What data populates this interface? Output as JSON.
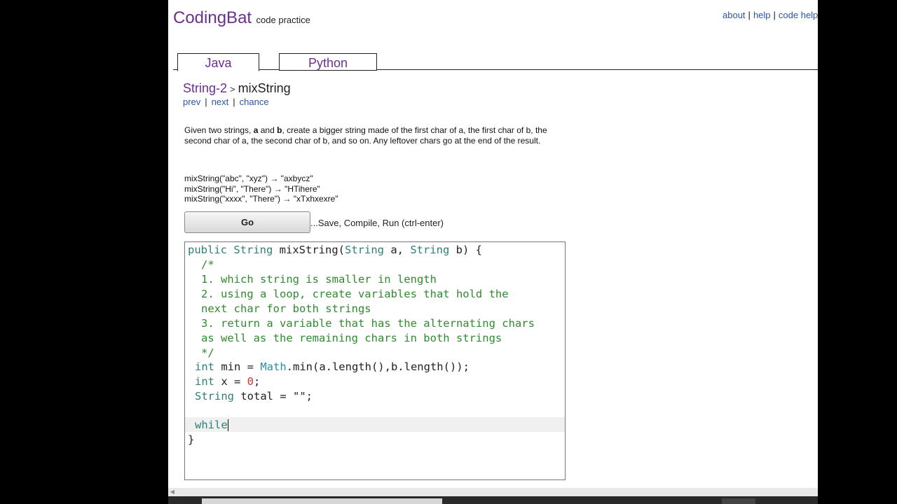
{
  "header": {
    "brand": "CodingBat",
    "tagline": "code practice",
    "links": [
      "about",
      "help",
      "code help"
    ]
  },
  "tabs": [
    {
      "label": "Java",
      "active": true
    },
    {
      "label": "Python",
      "active": false
    }
  ],
  "problem": {
    "group": "String-2",
    "separator": ">",
    "name": "mixString",
    "nav": [
      "prev",
      "next",
      "chance"
    ],
    "description_parts": {
      "p1": "Given two strings, ",
      "a": "a",
      "p2": " and ",
      "b": "b",
      "p3": ", create a bigger string made of the first char of a, the first char of b, the second char of a, the second char of b, and so on. Any leftover chars go at the end of the result."
    },
    "examples": [
      "mixString(\"abc\", \"xyz\") → \"axbycz\"",
      "mixString(\"Hi\", \"There\") → \"HTihere\"",
      "mixString(\"xxxx\", \"There\") → \"xTxhxexre\""
    ]
  },
  "run": {
    "button_label": "Go",
    "hint": "...Save, Compile, Run (ctrl-enter)"
  },
  "colors": {
    "brand": "#6b2f8c",
    "link": "#2a55a8",
    "keyword": "#2f7f78",
    "comment": "#2e8b2e",
    "number": "#c0392b"
  },
  "code": {
    "l1": {
      "kw1": "public",
      "kw2": "String",
      "rest1": " mixString(",
      "kw3": "String",
      "rest2": " a, ",
      "kw4": "String",
      "rest3": " b) {"
    },
    "l2": "/*",
    "l3": "1. which string is smaller in length",
    "l4": "2. using a loop, create variables that hold the",
    "l5": "next char for both strings",
    "l6": "3. return a variable that has the alternating chars",
    "l7": "as well as the remaining chars in both strings",
    "l8": "*/",
    "l9": {
      "kw": "int",
      "rest1": " min = ",
      "cls": "Math",
      "rest2": ".min(a.length(),b.length());"
    },
    "l10": {
      "kw": "int",
      "rest1": " x = ",
      "num": "0",
      "rest2": ";"
    },
    "l11": {
      "kw": "String",
      "rest": " total = \"\";"
    },
    "l13": "while",
    "l14": "}"
  }
}
